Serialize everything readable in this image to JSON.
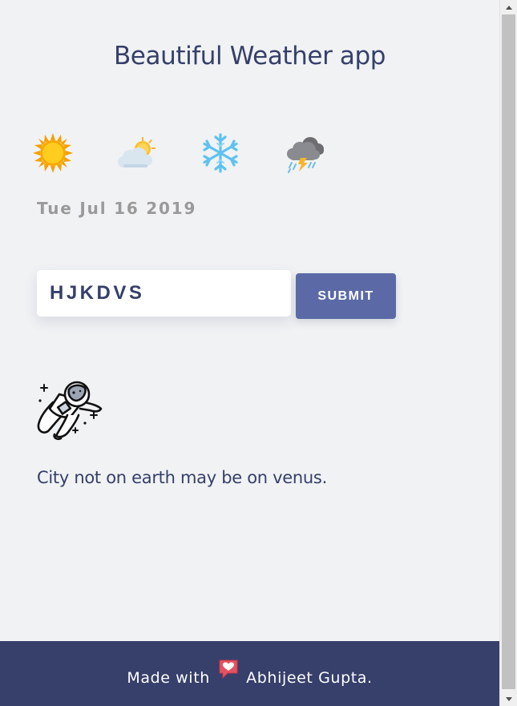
{
  "header": {
    "title": "Beautiful Weather app"
  },
  "weather_icons": [
    "sun-icon",
    "partly-cloudy-icon",
    "snowflake-icon",
    "thunderstorm-icon"
  ],
  "date": "Tue Jul 16 2019",
  "search": {
    "value": "HJKDVS",
    "placeholder": ""
  },
  "submit_label": "SUBMIT",
  "result": {
    "icon": "astronaut-icon",
    "message": "City not on earth may be on venus."
  },
  "footer": {
    "made_with": "Made with",
    "author": "Abhijeet Gupta."
  },
  "colors": {
    "background": "#f1f2f4",
    "text_primary": "#35406a",
    "button": "#5b6aa6",
    "footer": "#373f6b",
    "date_text": "#9a9a9a"
  }
}
